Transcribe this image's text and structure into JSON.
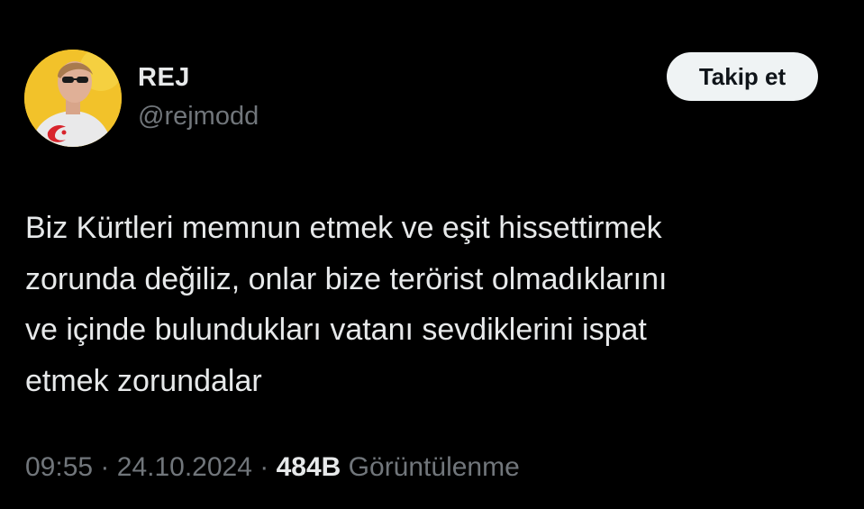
{
  "user": {
    "display_name": "REJ",
    "handle": "@rejmodd",
    "avatar_icon": "profile-photo"
  },
  "follow_button": {
    "label": "Takip et"
  },
  "tweet": {
    "text": "Biz Kürtleri memnun etmek ve eşit hissettirmek\nzorunda değiliz, onlar bize terörist olmadıklarını\nve içinde bulundukları vatanı sevdiklerini ispat\netmek zorundalar"
  },
  "meta": {
    "time": "09:55",
    "separator": "·",
    "date": "24.10.2024",
    "views_count": "484B",
    "views_label": "Görüntülenme"
  },
  "colors": {
    "background": "#000000",
    "primary_text": "#e7e9ea",
    "secondary_text": "#71767b",
    "button_bg": "#eff3f4",
    "button_text": "#0f1419",
    "avatar_bg": "#f2c22a"
  }
}
